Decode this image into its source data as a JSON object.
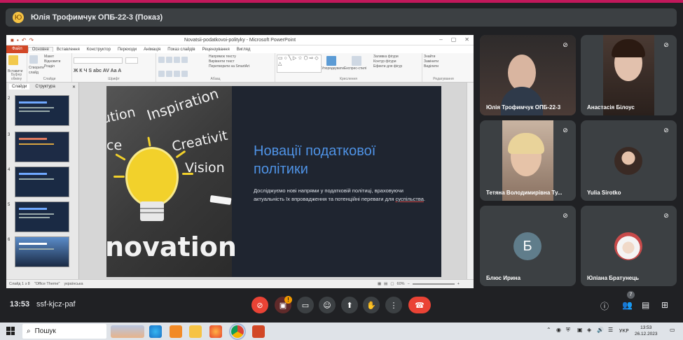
{
  "presenter_bar": {
    "avatar_letter": "Ю",
    "title": "Юлія Трофимчук ОПБ-22-3 (Показ)"
  },
  "powerpoint": {
    "window_title": "Novatsii-podatkovoi-polityky - Microsoft PowerPoint",
    "tabs": [
      "Файл",
      "Основне",
      "Вставлення",
      "Конструктор",
      "Переходи",
      "Анімація",
      "Показ слайдів",
      "Рецензування",
      "Вигляд"
    ],
    "active_tab": "Основне",
    "ribbon_groups": [
      "Буфер обміну",
      "Слайди",
      "Шрифт",
      "Абзац",
      "Креслення",
      "Редагування"
    ],
    "ribbon_labels": {
      "paste": "Вставити",
      "new_slide": "Створити слайд",
      "layout": "Макет",
      "reset": "Відновити",
      "section": "Розділ",
      "find": "Знайти",
      "replace": "Замінити",
      "select": "Виділити",
      "arrange": "Упорядкувати",
      "quick_styles": "Експрес-стилі",
      "shape_fill": "Заливка фігури",
      "shape_outline": "Контур фігури",
      "shape_effects": "Ефекти для фігур",
      "text_direction": "Напрямок тексту",
      "align_text": "Вирівняти текст",
      "smartart": "Перетворити на SmartArt"
    },
    "pane_tabs": [
      "Слайди",
      "Структура"
    ],
    "slide_numbers": [
      "2",
      "3",
      "4",
      "5",
      "6"
    ],
    "status": {
      "slide": "Слайд 1 з 8",
      "theme": "\"Office Theme\"",
      "lang": "українська",
      "zoom": "60%"
    },
    "slide": {
      "title": "Новації податкової політики",
      "body_prefix": "Досліджуємо нові напрями  у податковій політиці, враховуючи актуальність їх впровадження та потенційні переваги для ",
      "body_link": "суспільства",
      "body_suffix": ".",
      "image_words": [
        "ution",
        "Inspiration",
        "ce",
        "Creativit",
        "Vision",
        "novation"
      ]
    }
  },
  "participants": [
    {
      "name": "Юлія Трофимчук ОПБ-22-3",
      "muted": true
    },
    {
      "name": "Анастасія Білоус",
      "muted": true
    },
    {
      "name": "Тетяна Володимирівна Ту...",
      "muted": true
    },
    {
      "name": "Yulia Sirotko",
      "muted": true
    },
    {
      "name": "Блюс Ирина",
      "initial": "Б",
      "muted": true
    },
    {
      "name": "Юліана Братунець",
      "muted": true
    }
  ],
  "bottom": {
    "time": "13:53",
    "meeting_code": "ssf-kjcz-paf",
    "participant_count": "7",
    "warning_badge": "!"
  },
  "taskbar": {
    "search_placeholder": "Пошук",
    "lang": "УКР",
    "clock_time": "13:53",
    "clock_date": "26.12.2023"
  },
  "colors": {
    "background": "#202124",
    "tile": "#3c4043",
    "red": "#ea4335",
    "slide_title": "#4f93e6"
  }
}
